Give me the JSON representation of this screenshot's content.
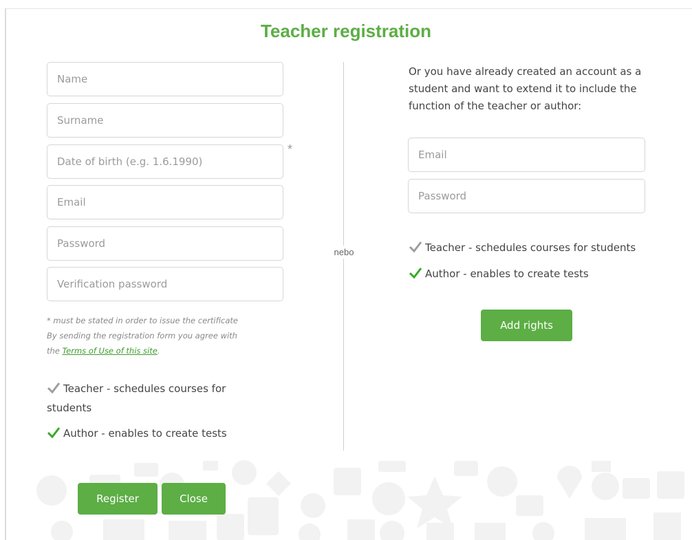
{
  "title": "Teacher registration",
  "left_form": {
    "name_placeholder": "Name",
    "surname_placeholder": "Surname",
    "dob_placeholder": "Date of birth (e.g. 1.6.1990)",
    "dob_required_marker": "*",
    "email_placeholder": "Email",
    "password_placeholder": "Password",
    "verify_password_placeholder": "Verification password",
    "note_required": "* must be stated in order to issue the certificate",
    "note_agree": "By sending the registration form you agree with",
    "note_the": "the",
    "terms_link": "Terms of Use of this site",
    "note_period": ".",
    "teacher_check_label": "Teacher - schedules courses for students",
    "teacher_checked": false,
    "author_check_label": "Author - enables to create tests",
    "author_checked": true
  },
  "divider_label": "nebo",
  "right_form": {
    "intro": "Or you have already created an account as a student and want to extend it to include the function of the teacher or author:",
    "email_placeholder": "Email",
    "password_placeholder": "Password",
    "teacher_check_label": "Teacher - schedules courses for students",
    "teacher_checked": false,
    "author_check_label": "Author - enables to create tests",
    "author_checked": true,
    "add_rights_label": "Add rights"
  },
  "buttons": {
    "register_label": "Register",
    "close_label": "Close"
  },
  "colors": {
    "accent": "#5cae45",
    "check_active": "#3aa82a",
    "check_inactive": "#9e9e9e"
  }
}
